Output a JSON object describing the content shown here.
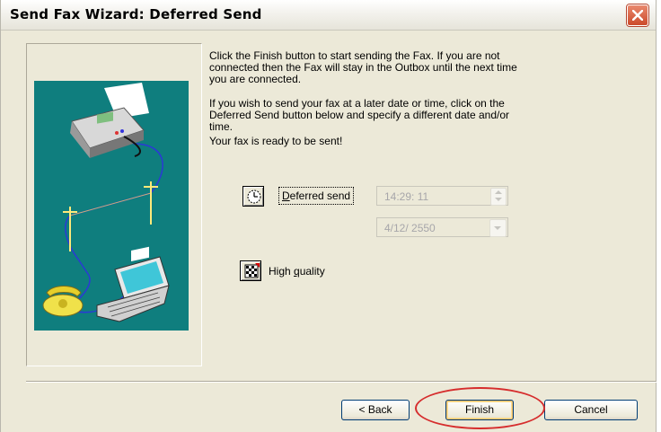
{
  "window": {
    "title": "Send Fax Wizard: Deferred Send"
  },
  "message": {
    "line1": "Click the Finish button to start sending the Fax. If you are not",
    "line2": "connected then the Fax will stay in the Outbox until the next time",
    "line3": "you are connected.",
    "line4": "If you wish to send your fax at a later date or time, click on the",
    "line5": "Deferred Send button below and specify a different date and/or",
    "line6": "time.",
    "line7": "Your fax is ready to be sent!"
  },
  "deferred": {
    "label_prefix": "",
    "label_accel": "D",
    "label_rest": "eferred send",
    "time_value": "14:29: 11",
    "date_value": "4/12/ 2550"
  },
  "quality": {
    "label_prefix": "High ",
    "label_accel": "q",
    "label_rest": "uality"
  },
  "buttons": {
    "back": "< Back",
    "finish": "Finish",
    "cancel": "Cancel"
  },
  "colors": {
    "illustration_bg": "#0f7e7e",
    "highlight": "#d62d2d",
    "close_button": "#cc4a2b"
  }
}
